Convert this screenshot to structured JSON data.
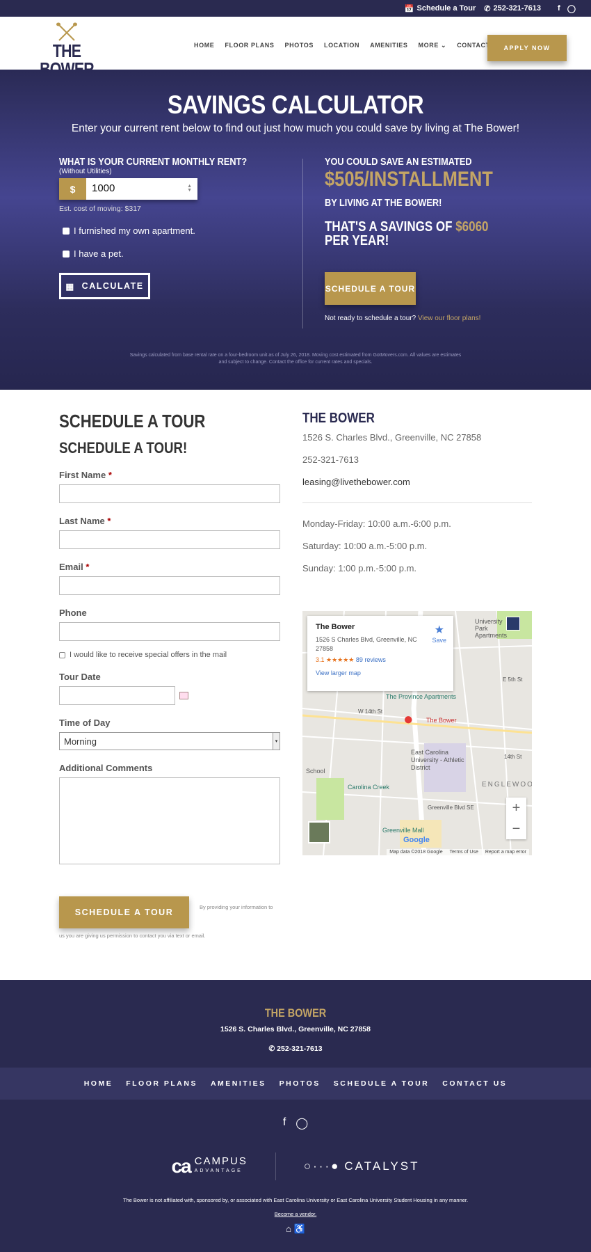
{
  "topbar": {
    "tour": "Schedule a Tour",
    "phone": "252-321-7613"
  },
  "brand": {
    "name": "THE BOWER"
  },
  "nav": [
    "HOME",
    "FLOOR PLANS",
    "PHOTOS",
    "LOCATION",
    "AMENITIES",
    "MORE",
    "CONTACT US"
  ],
  "apply": "APPLY NOW",
  "hero": {
    "title": "SAVINGS CALCULATOR",
    "subtitle": "Enter your current rent below to find out just how much you could save by living at The Bower!",
    "question": "WHAT IS YOUR CURRENT MONTHLY RENT?",
    "without": "(Without Utilities)",
    "currency": "$",
    "rent": "1000",
    "moving": "Est. cost of moving: $317",
    "furnished": "I furnished my own apartment.",
    "pet": "I have a pet.",
    "calculate": "CALCULATE",
    "save_pre": "YOU COULD SAVE AN ESTIMATED",
    "save_amount": "$505/INSTALLMENT",
    "save_post": "BY LIVING AT THE BOWER!",
    "year_pre": "THAT'S A SAVINGS OF ",
    "year_amount": "$6060",
    "year_post": " PER YEAR!",
    "tour": "SCHEDULE A TOUR",
    "notready": "Not ready to schedule a tour? ",
    "floorlink": "View our floor plans!",
    "disclaimer": "Savings calculated from base rental rate on a four-bedroom unit as of July 26, 2018. Moving cost estimated from GotMovers.com. All values are estimates and subject to change. Contact the office for current rates and specials."
  },
  "form": {
    "heading": "SCHEDULE A TOUR",
    "subheading": "SCHEDULE A TOUR!",
    "first": "First Name",
    "last": "Last Name",
    "email": "Email",
    "phone": "Phone",
    "required": "*",
    "offers": "I would like to receive special offers in the mail",
    "date": "Tour Date",
    "time": "Time of Day",
    "time_value": "Morning",
    "comments": "Additional Comments",
    "submit": "SCHEDULE A TOUR",
    "note1": "By providing your information to",
    "note2": "us you are giving us permission to contact you via text or email."
  },
  "info": {
    "name": "THE BOWER",
    "address": "1526 S. Charles Blvd., Greenville, NC 27858",
    "phone": "252-321-7613",
    "email": "leasing@livethebower.com",
    "hours": [
      "Monday-Friday: 10:00 a.m.-6:00 p.m.",
      "Saturday: 10:00 a.m.-5:00 p.m.",
      "Sunday: 1:00 p.m.-5:00 p.m."
    ]
  },
  "map": {
    "title": "The Bower",
    "address": "1526 S Charles Blvd, Greenville, NC 27858",
    "rating": "3.1",
    "stars": "★★★★★",
    "reviews": "89 reviews",
    "save": "Save",
    "larger": "View larger map",
    "labels": [
      "The Province Apartments",
      "The Bower",
      "East Carolina University - Athletic District",
      "Carolina Creek",
      "Greenville Mall",
      "ENGLEWOOD",
      "University Park Apartments",
      "School",
      "E 5th St",
      "W 14th St",
      "14th St",
      "Greenville Blvd SE"
    ],
    "footer": [
      "Map data ©2018 Google",
      "Terms of Use",
      "Report a map error"
    ],
    "google": "Google"
  },
  "footer": {
    "name": "THE BOWER",
    "address": "1526 S. Charles Blvd., Greenville, NC 27858",
    "phone": "252-321-7613",
    "nav": [
      "HOME",
      "FLOOR PLANS",
      "AMENITIES",
      "PHOTOS",
      "SCHEDULE A TOUR",
      "CONTACT US"
    ],
    "campus": "CAMPUS",
    "advantage": "ADVANTAGE",
    "catalyst": "CATALYST",
    "disclaimer": "The Bower is not affiliated with, sponsored by, or associated with East Carolina University or East Carolina University Student Housing in any manner.",
    "vendor": "Become a vendor."
  }
}
